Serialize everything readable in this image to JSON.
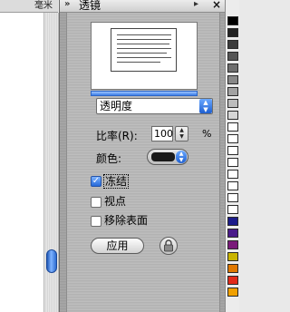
{
  "canvas": {
    "ruler_label": "毫米"
  },
  "panel": {
    "title": "透镜",
    "lens_type": "透明度",
    "ratio_label": "比率(R):",
    "ratio_value": "100",
    "percent_sign": "%",
    "color_label": "颜色:",
    "color_value": "#1a1a1a",
    "options": [
      {
        "label": "冻结",
        "checked": true
      },
      {
        "label": "视点",
        "checked": false
      },
      {
        "label": "移除表面",
        "checked": false
      }
    ],
    "apply_label": "应用"
  },
  "palette": {
    "colors": [
      "#000000",
      "#232323",
      "#3b3b3b",
      "#555555",
      "#6e6e6e",
      "#888888",
      "#a2a2a2",
      "#bcbcbc",
      "#d6d6d6",
      "#ffffff",
      "#ffffff",
      "#ffffff",
      "#ffffff",
      "#ffffff",
      "#ffffff",
      "#ffffff",
      "#ffffff",
      "#1b1b8a",
      "#4a1a8a",
      "#7a1a7a",
      "#c9b400",
      "#e07800",
      "#e12a1a",
      "#f0a000"
    ]
  }
}
